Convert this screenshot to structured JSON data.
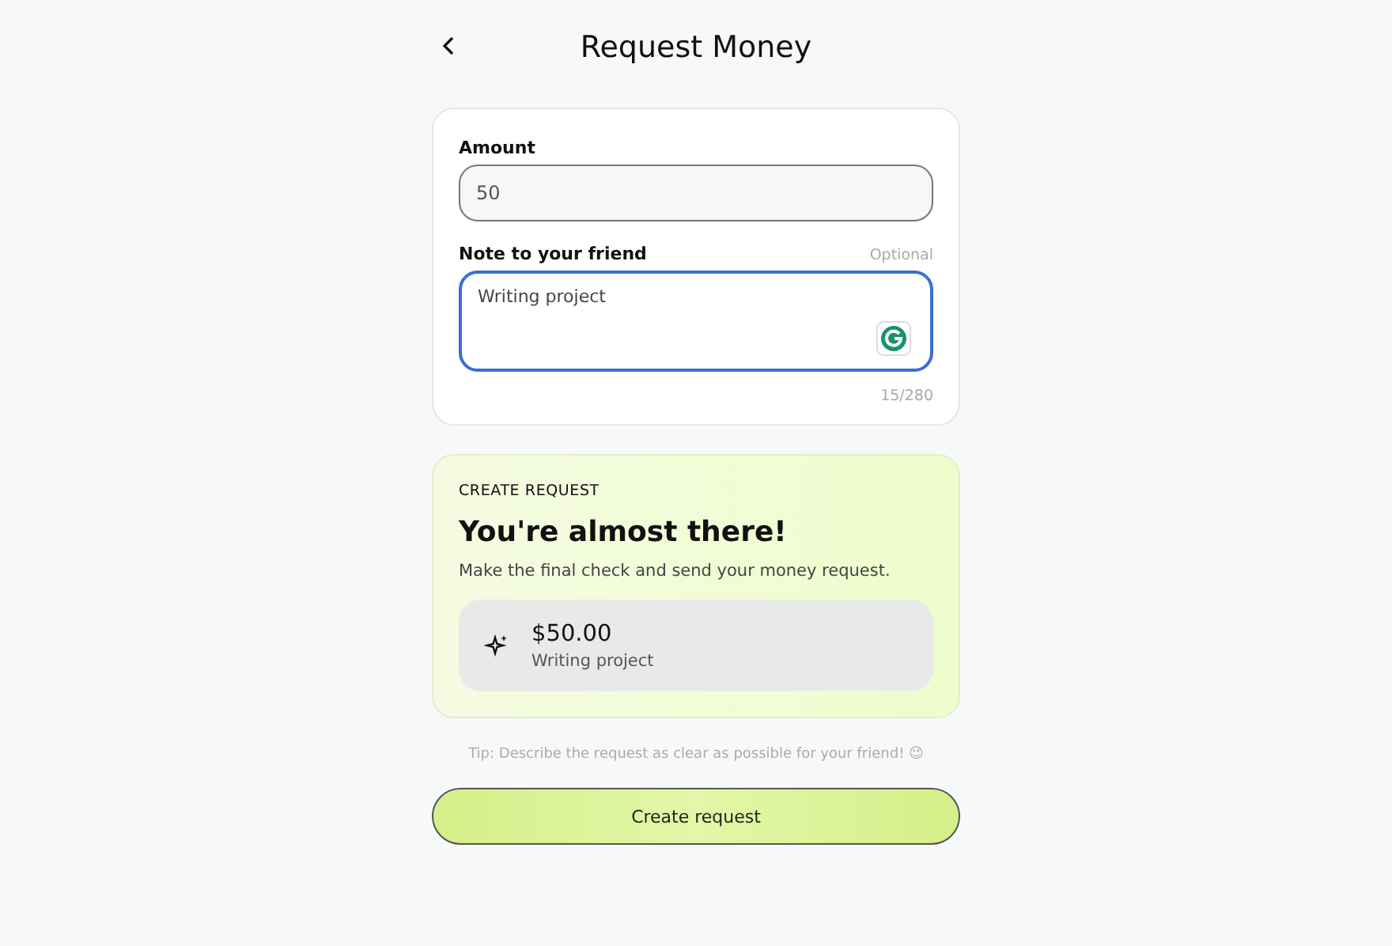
{
  "header": {
    "title": "Request Money"
  },
  "form": {
    "amount": {
      "label": "Amount",
      "value": "50",
      "focused": false
    },
    "note": {
      "label": "Note to your friend",
      "hint": "Optional",
      "value": "Writing project",
      "focused": true,
      "counter": "15/280"
    }
  },
  "summary": {
    "eyebrow": "CREATE REQUEST",
    "heading": "You're almost there!",
    "description": "Make the final check and send your money request.",
    "amount": "$50.00",
    "note": "Writing project"
  },
  "tip": "Tip: Describe the request as clear as possible for your friend! 😉",
  "submit_button": {
    "label": "Create request"
  }
}
